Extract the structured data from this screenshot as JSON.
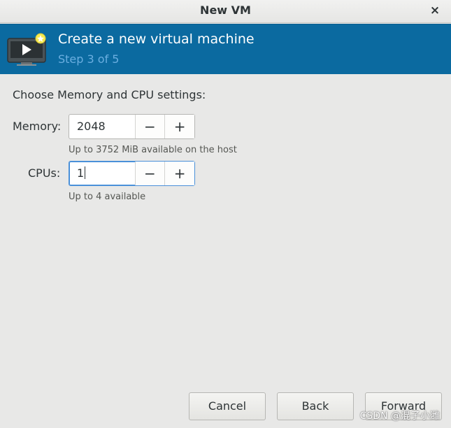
{
  "window": {
    "title": "New VM",
    "close_glyph": "×"
  },
  "header": {
    "icon": "vm-monitor-icon",
    "title": "Create a new virtual machine",
    "step": "Step 3 of 5",
    "colors": {
      "banner": "#0b6aa0",
      "step_text": "#6aaee0"
    }
  },
  "content": {
    "section_label": "Choose Memory and CPU settings:",
    "memory": {
      "label": "Memory:",
      "value": "2048",
      "decrement": "−",
      "increment": "+",
      "hint": "Up to 3752 MiB available on the host"
    },
    "cpus": {
      "label": "CPUs:",
      "value": "1",
      "decrement": "−",
      "increment": "+",
      "hint": "Up to 4 available"
    }
  },
  "footer": {
    "cancel_label": "Cancel",
    "back_label": "Back",
    "forward_label": "Forward"
  },
  "watermark": "CSDN @混子小潍"
}
